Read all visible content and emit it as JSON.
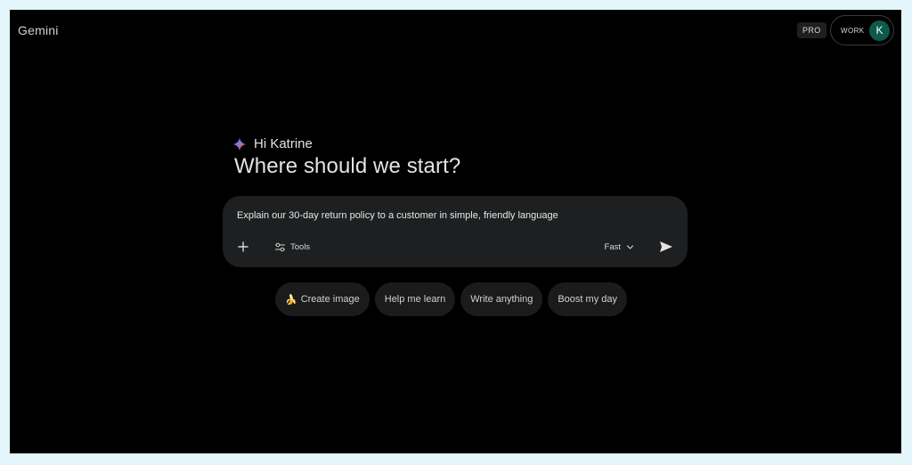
{
  "header": {
    "brand": "Gemini",
    "plan_badge": "PRO",
    "workspace_label": "WORK",
    "avatar_initial": "K"
  },
  "greeting": {
    "hello": "Hi Katrine",
    "headline": "Where should we start?"
  },
  "composer": {
    "prompt_text": "Explain our 30-day return policy to a customer in simple, friendly language",
    "tools_label": "Tools",
    "model_label": "Fast",
    "icons": {
      "add": "plus-icon",
      "tools": "sliders-icon",
      "model": "chevron-down-icon",
      "send": "send-icon"
    }
  },
  "suggestions": [
    {
      "label": "Create image",
      "icon": "🍌"
    },
    {
      "label": "Help me learn"
    },
    {
      "label": "Write anything"
    },
    {
      "label": "Boost my day"
    }
  ],
  "colors": {
    "background": "#000000",
    "composer": "#1e1f20",
    "avatar": "#0d5a4a",
    "spark_blue": "#4285f4",
    "spark_red": "#ea4335",
    "spark_yellow": "#fbbc04"
  }
}
